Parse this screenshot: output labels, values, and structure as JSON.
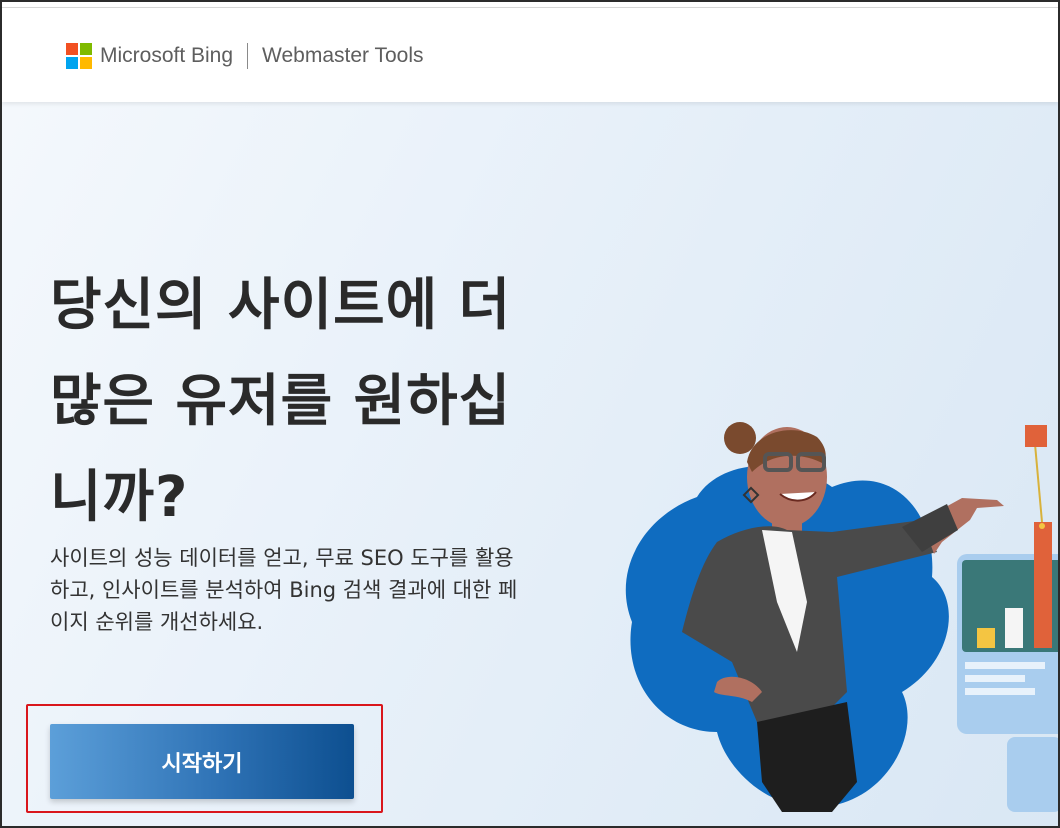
{
  "header": {
    "brand_name": "Microsoft Bing",
    "product_name": "Webmaster Tools",
    "logo_colors": [
      "#f25022",
      "#7fba00",
      "#00a4ef",
      "#ffb900"
    ]
  },
  "hero": {
    "headline_lines": [
      "당신의 사이트에 더",
      "많은 유저를 원하십",
      "니까?"
    ],
    "description_lines": [
      "사이트의 성능 데이터를 얻고, 무료 SEO 도구를 활용",
      "하고, 인사이트를 분석하여 Bing 검색 결과에 대한 페",
      "이지 순위를 개선하세요."
    ],
    "cta_label": "시작하기"
  },
  "colors": {
    "accent": "#1565c0",
    "highlight_outline": "#d9161c",
    "headline": "#2a2a2a"
  },
  "illustration": {
    "icon": "woman-pointing-at-chart-illustration"
  }
}
